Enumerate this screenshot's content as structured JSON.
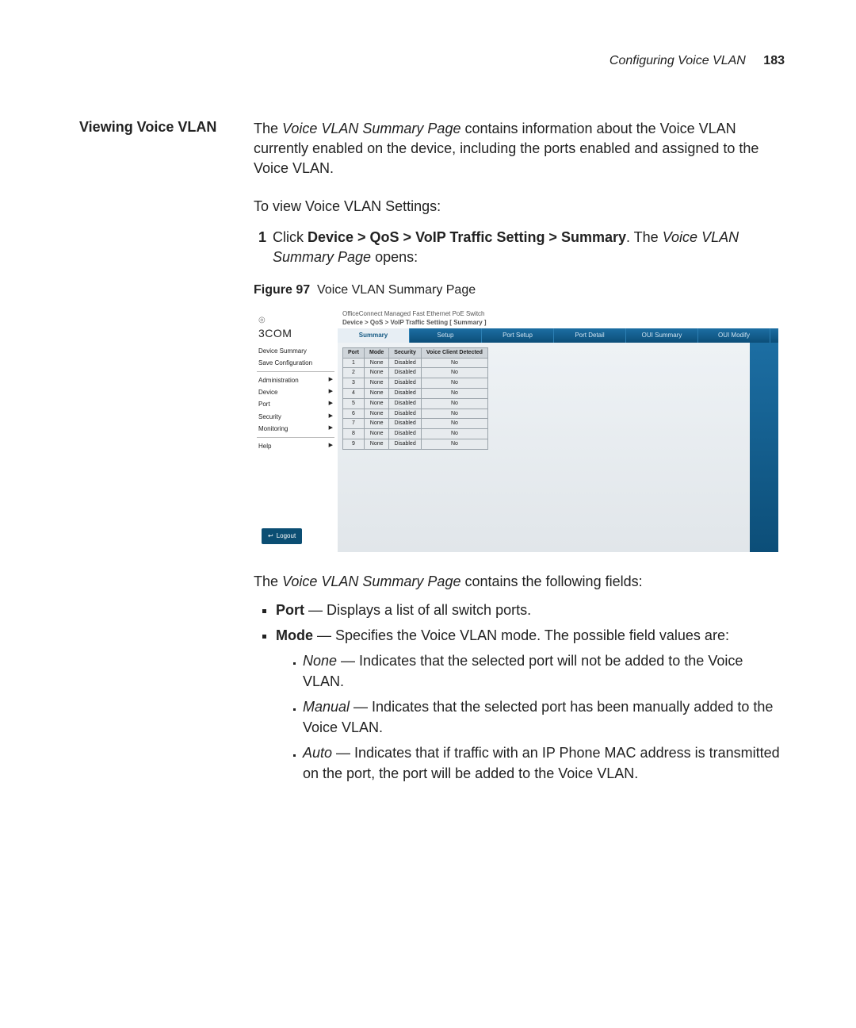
{
  "runningHead": {
    "title": "Configuring Voice VLAN",
    "page": "183"
  },
  "side": {
    "heading": "Viewing Voice VLAN"
  },
  "intro": {
    "t1a": "The ",
    "t1b": "Voice VLAN Summary Page",
    "t1c": " contains information about the Voice VLAN currently enabled on the device, including the ports enabled and assigned to the Voice VLAN.",
    "t2": "To view Voice VLAN Settings:"
  },
  "step1": {
    "n": "1",
    "pre": "Click ",
    "bold": "Device > QoS > VoIP Traffic Setting > Summary",
    "post1": ". The ",
    "em": "Voice VLAN Summary Page",
    "post2": " opens:"
  },
  "figure": {
    "label": "Figure 97",
    "caption": "Voice VLAN Summary Page"
  },
  "ui": {
    "brand": "3COM",
    "brandIcon": "◎",
    "deviceTitle": "OfficeConnect Managed Fast Ethernet PoE Switch",
    "breadcrumb": "Device > QoS > VoIP Traffic Setting [ Summary ]",
    "menu": {
      "deviceSummary": "Device Summary",
      "saveConfig": "Save Configuration",
      "administration": "Administration",
      "device": "Device",
      "port": "Port",
      "security": "Security",
      "monitoring": "Monitoring",
      "help": "Help"
    },
    "logout": "Logout",
    "logoutIcon": "↩",
    "tabs": {
      "summary": "Summary",
      "setup": "Setup",
      "portSetup": "Port Setup",
      "portDetail": "Port Detail",
      "ouiSummary": "OUI Summary",
      "ouiModify": "OUI Modify"
    },
    "cols": {
      "port": "Port",
      "mode": "Mode",
      "security": "Security",
      "vcd": "Voice Client Detected"
    }
  },
  "chart_data": {
    "type": "table",
    "columns": [
      "Port",
      "Mode",
      "Security",
      "Voice Client Detected"
    ],
    "rows": [
      [
        "1",
        "None",
        "Disabled",
        "No"
      ],
      [
        "2",
        "None",
        "Disabled",
        "No"
      ],
      [
        "3",
        "None",
        "Disabled",
        "No"
      ],
      [
        "4",
        "None",
        "Disabled",
        "No"
      ],
      [
        "5",
        "None",
        "Disabled",
        "No"
      ],
      [
        "6",
        "None",
        "Disabled",
        "No"
      ],
      [
        "7",
        "None",
        "Disabled",
        "No"
      ],
      [
        "8",
        "None",
        "Disabled",
        "No"
      ],
      [
        "9",
        "None",
        "Disabled",
        "No"
      ]
    ]
  },
  "after": {
    "lead1": "The ",
    "leadEm": "Voice VLAN Summary Page",
    "lead2": " contains the following fields:",
    "portB": "Port",
    "portT": " — Displays a list of all switch ports.",
    "modeB": "Mode",
    "modeT": " — Specifies the Voice VLAN mode. The possible field values are:",
    "noneEm": "None",
    "noneT": " — Indicates that the selected port will not be added to the Voice VLAN.",
    "manualEm": "Manual",
    "manualT": " — Indicates that the selected port has been manually added to the Voice VLAN.",
    "autoEm": "Auto",
    "autoT": " — Indicates that if traffic with an IP Phone MAC address is transmitted on the port, the port will be added to the Voice VLAN."
  }
}
